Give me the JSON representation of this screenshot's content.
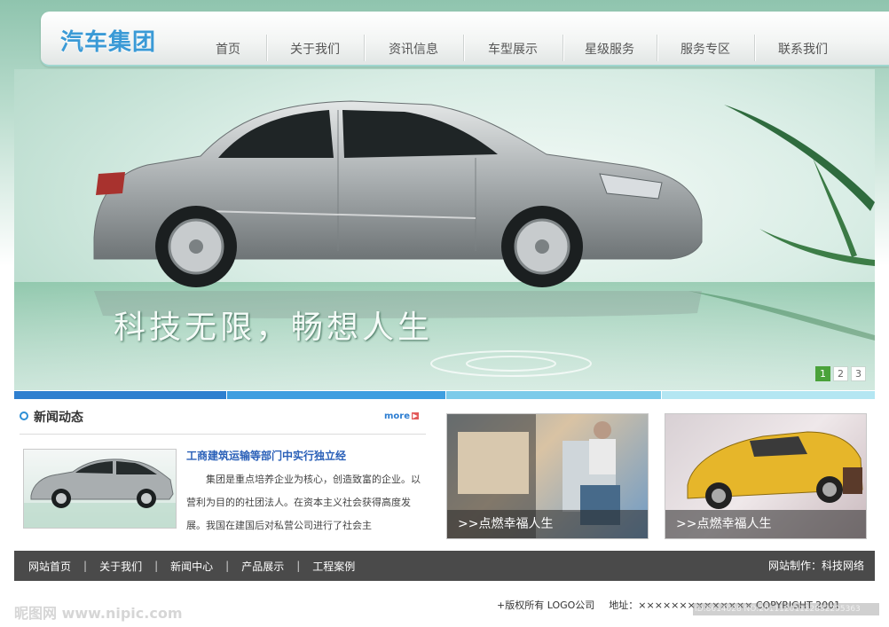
{
  "header": {
    "logo": "汽车集团",
    "nav": [
      "首页",
      "关于我们",
      "资讯信息",
      "车型展示",
      "星级服务",
      "服务专区",
      "联系我们"
    ]
  },
  "banner": {
    "slogan": "科技无限，畅想人生",
    "pages": [
      "1",
      "2",
      "3"
    ],
    "active_page": "1"
  },
  "strip_colors": [
    "#2e7fcf",
    "#3e9ee0",
    "#7ccbea",
    "#b4e6f2"
  ],
  "news": {
    "title": "新闻动态",
    "more": "more",
    "headline": "工商建筑运输等部门中实行独立经",
    "body": "集团是重点培养企业为核心，创造致富的企业。以营利为目的的社团法人。在资本主义社会获得高度发展。我国在建国后对私营公司进行了社会主"
  },
  "cards": [
    {
      "caption": ">>点燃幸福人生"
    },
    {
      "caption": ">>点燃幸福人生"
    }
  ],
  "footer": {
    "links": [
      "网站首页",
      "关于我们",
      "新闻中心",
      "产品展示",
      "工程案例"
    ],
    "credit": "网站制作：科技网络",
    "copyright": "+版权所有 LOGO公司",
    "address": "地址：×××××××××××××× COPYRIGHT 2001"
  },
  "watermark": {
    "left": "昵图网 www.nipic.com",
    "right": "ID:8614028 NO:20111201122832295363"
  },
  "colors": {
    "accent_blue": "#2e7fcf",
    "logo_blue": "#3a9ad6",
    "pager_active": "#4aa23a",
    "footer_bg": "#4a4a4a"
  }
}
